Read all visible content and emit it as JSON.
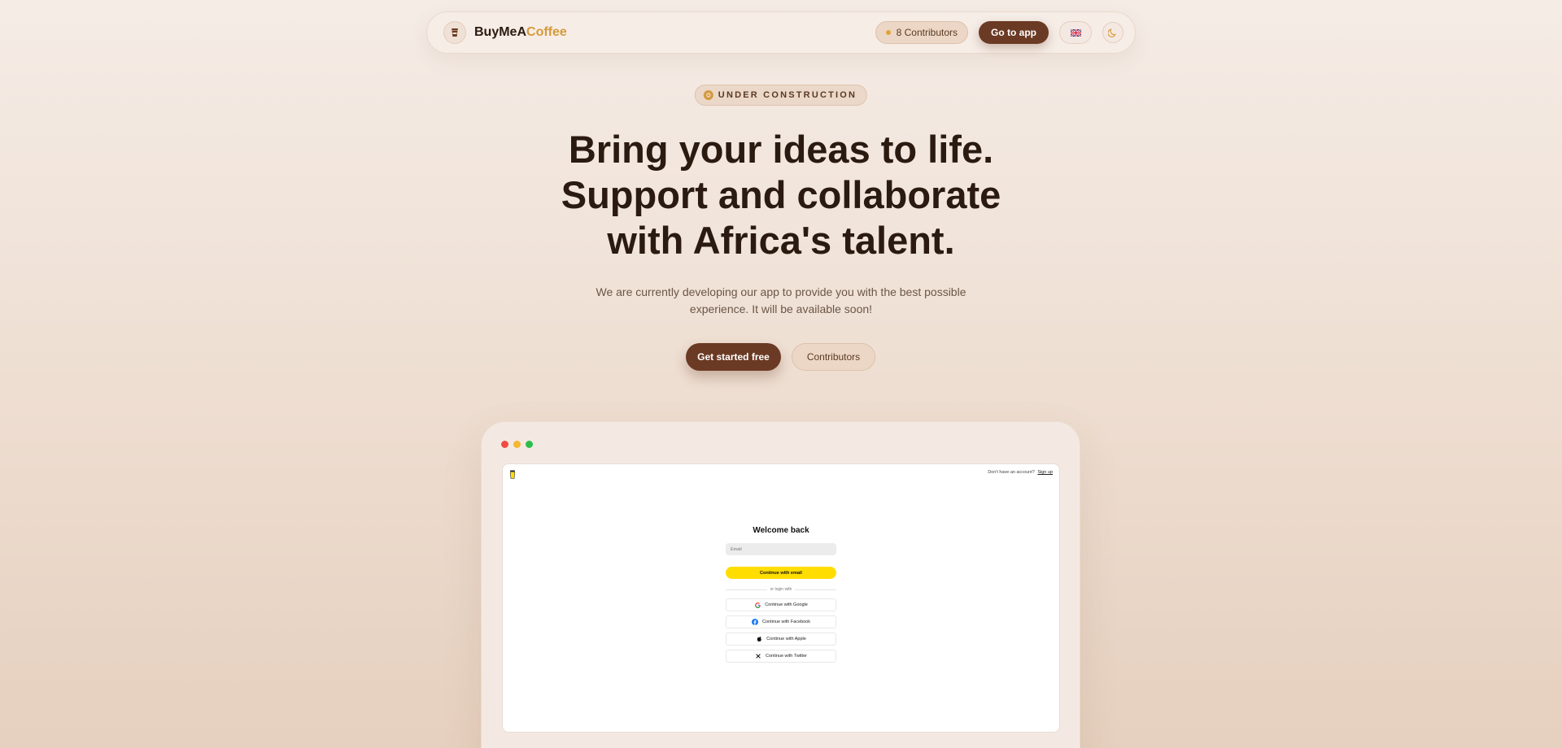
{
  "navbar": {
    "brand_main": "BuyMeA",
    "brand_accent": "Coffee",
    "contributors_label": "8 Contributors",
    "go_to_app": "Go to app",
    "language_flag": "🇬🇧",
    "theme_icon": "moon-icon"
  },
  "hero": {
    "badge": "UNDER CONSTRUCTION",
    "headline_lines": [
      "Bring your ideas to life.",
      "Support and collaborate",
      "with Africa's talent."
    ],
    "subtext_lines": [
      "We are currently developing our app to provide you with the best possible",
      "experience. It will be available soon!"
    ],
    "primary_cta": "Get started free",
    "secondary_cta": "Contributors"
  },
  "preview": {
    "signup_prompt": "Don't have an account?",
    "signup_link": "Sign up",
    "login_title": "Welcome back",
    "email_placeholder": "Email",
    "continue_email": "Continue with email",
    "divider_text": "or login with",
    "social_buttons": [
      {
        "label": "Continue with Google",
        "icon": "google-icon"
      },
      {
        "label": "Continue with Facebook",
        "icon": "facebook-icon"
      },
      {
        "label": "Continue with Apple",
        "icon": "apple-icon"
      },
      {
        "label": "Continue with Twitter",
        "icon": "x-icon"
      }
    ]
  },
  "colors": {
    "primary_brown": "#6b3a24",
    "accent_gold": "#d69a3a",
    "cta_yellow": "#ffdd00"
  }
}
